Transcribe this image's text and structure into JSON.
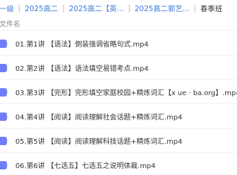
{
  "breadcrumb": {
    "items": [
      "一级",
      "2025高二",
      "2025高二【英...",
      "2025高二郭艺...",
      "春季班"
    ],
    "separator": "|"
  },
  "columns": {
    "filename": "文件名"
  },
  "files": [
    {
      "name": "01.第1讲 【语法】倒装强调省略句式.mp4"
    },
    {
      "name": "02.第2讲 【语法】语法填空易错考点.mp4"
    },
    {
      "name": "03.第3讲 【完形】完形填空家庭校园+精炼词汇【x ue · ba.org】.mp4"
    },
    {
      "name": "04.第4讲 【阅读】阅读理解社会话题+精炼词汇.mp4"
    },
    {
      "name": "05.第5讲 【阅读】阅读理解科技话题+精炼词汇.mp4"
    },
    {
      "name": "06.第6讲 【七选五】七选五之说明体裁.mp4"
    }
  ],
  "colors": {
    "accent": "#3a7bd5",
    "video_icon": "#6f7ef6"
  },
  "icons": {
    "file": "video-file-icon"
  }
}
